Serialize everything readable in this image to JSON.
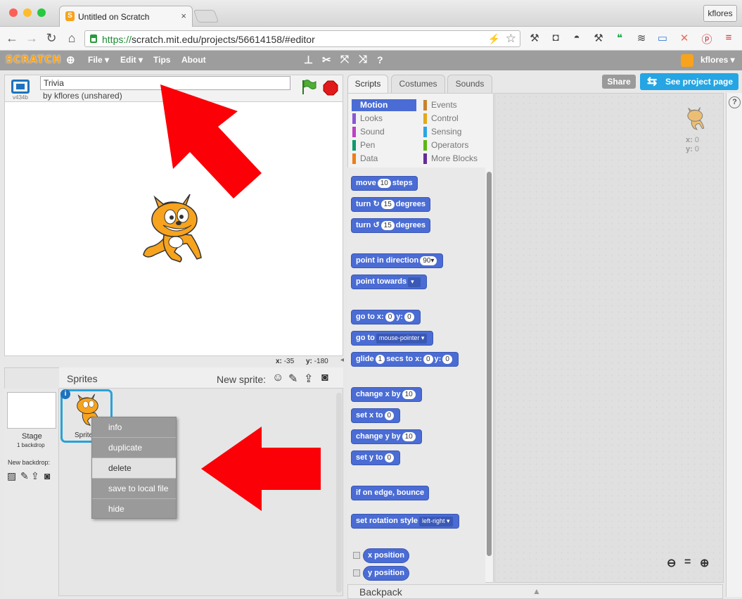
{
  "browser": {
    "tab_title": "Untitled on Scratch",
    "tab_close": "×",
    "user_chip": "kflores",
    "url_scheme": "https://",
    "url_rest": "scratch.mit.edu/projects/56614158/#editor"
  },
  "menubar": {
    "logo": "SCRATCH",
    "file": "File ▾",
    "edit": "Edit ▾",
    "tips": "Tips",
    "about": "About",
    "user": "kflores ▾"
  },
  "stage": {
    "version": "v434b",
    "title_value": "Trivia",
    "byline": "by kflores (unshared)",
    "x_label": "x:",
    "x_value": "-35",
    "y_label": "y:",
    "y_value": "-180"
  },
  "sprites_pane": {
    "heading": "Sprites",
    "new_sprite_label": "New sprite:",
    "stage_label": "Stage",
    "stage_backdrops": "1 backdrop",
    "new_backdrop_label": "New backdrop:",
    "sprite_name": "Sprite"
  },
  "context_menu": {
    "items": [
      "info",
      "duplicate",
      "delete",
      "save to local file",
      "hide"
    ],
    "highlighted": "delete"
  },
  "editor_tabs": [
    "Scripts",
    "Costumes",
    "Sounds"
  ],
  "actions": {
    "share": "Share",
    "see_project": "See project page"
  },
  "categories": [
    {
      "label": "Motion",
      "color": "#4a6cd4"
    },
    {
      "label": "Events",
      "color": "#c88330"
    },
    {
      "label": "Looks",
      "color": "#8a55d7"
    },
    {
      "label": "Control",
      "color": "#e1a91a"
    },
    {
      "label": "Sound",
      "color": "#bb42c3"
    },
    {
      "label": "Sensing",
      "color": "#2ca5e2"
    },
    {
      "label": "Pen",
      "color": "#0e9a6c"
    },
    {
      "label": "Operators",
      "color": "#5cb712"
    },
    {
      "label": "Data",
      "color": "#ee7d16"
    },
    {
      "label": "More Blocks",
      "color": "#632d99"
    }
  ],
  "blocks": {
    "move": {
      "a": "move",
      "v": "10",
      "b": "steps"
    },
    "turn_cw": {
      "a": "turn",
      "icon": "↻",
      "v": "15",
      "b": "degrees"
    },
    "turn_ccw": {
      "a": "turn",
      "icon": "↺",
      "v": "15",
      "b": "degrees"
    },
    "point_dir": {
      "a": "point in direction",
      "v": "90▾"
    },
    "point_towards": {
      "a": "point towards"
    },
    "goto_xy": {
      "a": "go to x:",
      "v1": "0",
      "b": "y:",
      "v2": "0"
    },
    "goto": {
      "a": "go to",
      "dd": "mouse-pointer ▾"
    },
    "glide": {
      "a": "glide",
      "v1": "1",
      "b": "secs to x:",
      "v2": "0",
      "c": "y:",
      "v3": "0"
    },
    "change_x": {
      "a": "change x by",
      "v": "10"
    },
    "set_x": {
      "a": "set x to",
      "v": "0"
    },
    "change_y": {
      "a": "change y by",
      "v": "10"
    },
    "set_y": {
      "a": "set y to",
      "v": "0"
    },
    "bounce": {
      "a": "if on edge, bounce"
    },
    "rotation": {
      "a": "set rotation style",
      "dd": "left-right ▾"
    },
    "x_position": "x position",
    "y_position": "y position"
  },
  "script_area": {
    "x_label": "x:",
    "x_value": "0",
    "y_label": "y:",
    "y_value": "0"
  },
  "backpack": {
    "label": "Backpack"
  },
  "help": "?"
}
